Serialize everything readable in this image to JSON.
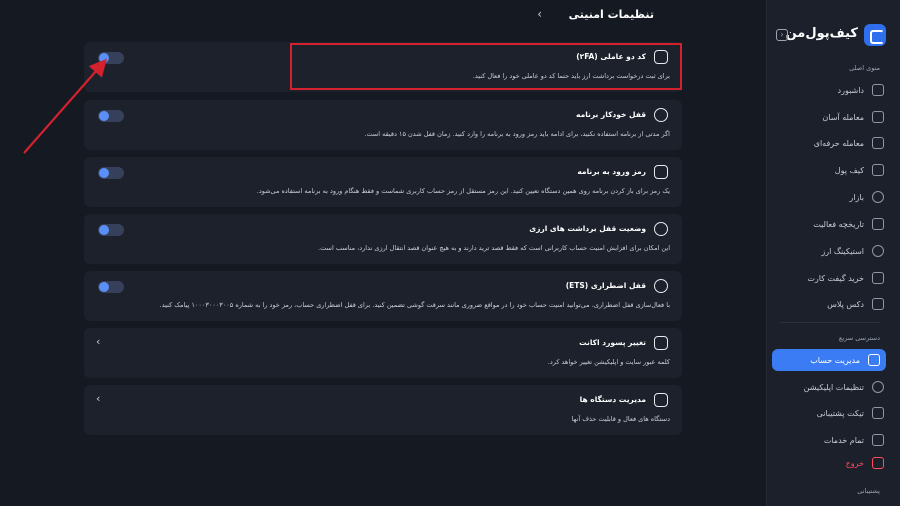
{
  "brand": {
    "name": "کیف‌پول‌من"
  },
  "page": {
    "title": "تنظیمات امنیتی"
  },
  "sidebar": {
    "main_menu_title": "منوی اصلی",
    "items": [
      {
        "label": "داشبورد",
        "icon": "dashboard-icon"
      },
      {
        "label": "معامله آسان",
        "icon": "exchange-icon"
      },
      {
        "label": "معامله حرفه‌ای",
        "icon": "pro-trade-icon"
      },
      {
        "label": "کیف پول",
        "icon": "wallet-icon"
      },
      {
        "label": "بازار",
        "icon": "market-icon"
      },
      {
        "label": "تاریخچه فعالیت",
        "icon": "history-icon"
      },
      {
        "label": "استیکینگ ارز",
        "icon": "staking-icon"
      },
      {
        "label": "خرید گیفت کارت",
        "icon": "gift-card-icon"
      },
      {
        "label": "دکس پلاس",
        "icon": "dex-icon"
      }
    ],
    "quick_access_title": "دسترسی سریع",
    "quick_items": [
      {
        "label": "مدیریت حساب",
        "icon": "account-icon",
        "active": true
      },
      {
        "label": "تنظیمات اپلیکیشن",
        "icon": "app-settings-icon"
      },
      {
        "label": "تیکت پشتیبانی",
        "icon": "ticket-icon"
      },
      {
        "label": "تمام خدمات",
        "icon": "services-icon"
      }
    ],
    "logout": "خروج",
    "support_title": "پشتیبانی"
  },
  "cards": [
    {
      "title": "کد دو عاملی (۲FA)",
      "desc": "برای ثبت درخواست برداشت ارز باید حتما کد دو عاملی خود را فعال کنید.",
      "control": "toggle",
      "icon": "grid-icon"
    },
    {
      "title": "قفل خودکار برنامه",
      "desc": "اگر مدتی از برنامه استفاده نکنید، برای ادامه باید رمز ورود به برنامه را وارد کنید. زمان قفل شدن ۱۵ دقیقه است.",
      "control": "toggle",
      "icon": "lock-icon"
    },
    {
      "title": "رمز ورود به برنامه",
      "desc": "یک رمز برای باز کردن برنامه روی همین دستگاه تعیین کنید. این رمز مستقل از رمز حساب کاربری شماست و فقط هنگام ورود به برنامه استفاده می‌شود.",
      "control": "toggle",
      "icon": "key-icon"
    },
    {
      "title": "وضعیت قفل برداشت های ارزی",
      "desc": "این امکان برای افزایش امنیت حساب کاربرانی است که فقط قصد ترید دارند و به هیچ عنوان قصد انتقال ارزی ندارد، مناسب است.",
      "control": "toggle",
      "icon": "lock-icon"
    },
    {
      "title": "قفل اضطراری (ETS)",
      "desc": "با فعال‌سازی قفل اضطراری، می‌توانید امنیت حساب خود را در مواقع ضروری مانند سرقت گوشی تضمین کنید. برای قفل اضطراری حساب، رمز خود را به شماره ۱۰۰۰۳۰۰۰۳۰۰۵ پیامک کنید.",
      "control": "toggle",
      "icon": "lock-icon"
    },
    {
      "title": "تغییر پسورد اکانت",
      "desc": "کلمه عبور سایت و اپلیکیشن تغییر خواهد کرد.",
      "control": "chevron",
      "icon": "password-icon"
    },
    {
      "title": "مدیریت دستگاه ها",
      "desc": "دستگاه های فعال و قابلیت حذف آنها",
      "control": "chevron",
      "icon": "device-icon"
    }
  ]
}
